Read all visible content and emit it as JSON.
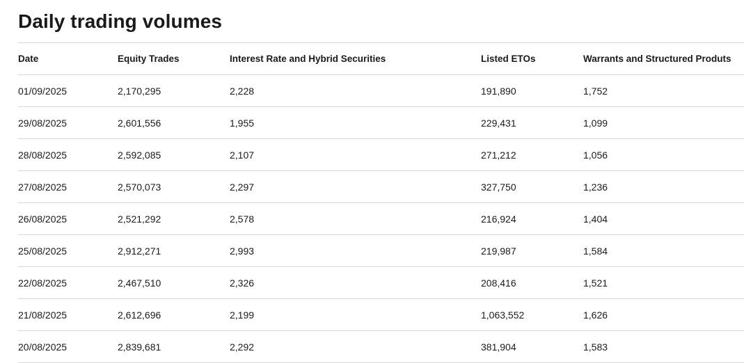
{
  "page": {
    "title": "Daily trading volumes"
  },
  "table": {
    "headers": {
      "date": "Date",
      "equity_trades": "Equity Trades",
      "interest_rate": "Interest Rate and Hybrid Securities",
      "listed_etos": "Listed ETOs",
      "warrants": "Warrants and Structured Produts"
    },
    "rows": [
      {
        "date": "01/09/2025",
        "equity_trades": "2,170,295",
        "interest_rate": "2,228",
        "listed_etos": "191,890",
        "warrants": "1,752"
      },
      {
        "date": "29/08/2025",
        "equity_trades": "2,601,556",
        "interest_rate": "1,955",
        "listed_etos": "229,431",
        "warrants": "1,099"
      },
      {
        "date": "28/08/2025",
        "equity_trades": "2,592,085",
        "interest_rate": "2,107",
        "listed_etos": "271,212",
        "warrants": "1,056"
      },
      {
        "date": "27/08/2025",
        "equity_trades": "2,570,073",
        "interest_rate": "2,297",
        "listed_etos": "327,750",
        "warrants": "1,236"
      },
      {
        "date": "26/08/2025",
        "equity_trades": "2,521,292",
        "interest_rate": "2,578",
        "listed_etos": "216,924",
        "warrants": "1,404"
      },
      {
        "date": "25/08/2025",
        "equity_trades": "2,912,271",
        "interest_rate": "2,993",
        "listed_etos": "219,987",
        "warrants": "1,584"
      },
      {
        "date": "22/08/2025",
        "equity_trades": "2,467,510",
        "interest_rate": "2,326",
        "listed_etos": "208,416",
        "warrants": "1,521"
      },
      {
        "date": "21/08/2025",
        "equity_trades": "2,612,696",
        "interest_rate": "2,199",
        "listed_etos": "1,063,552",
        "warrants": "1,626"
      },
      {
        "date": "20/08/2025",
        "equity_trades": "2,839,681",
        "interest_rate": "2,292",
        "listed_etos": "381,904",
        "warrants": "1,583"
      }
    ]
  }
}
